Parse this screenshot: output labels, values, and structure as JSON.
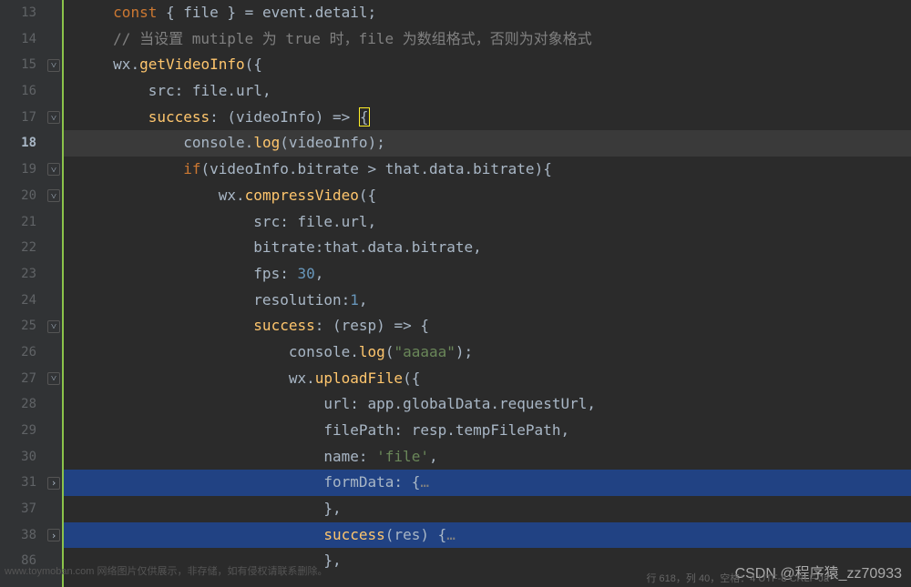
{
  "lines": [
    {
      "num": "13",
      "fold": "",
      "cls": ""
    },
    {
      "num": "14",
      "fold": "",
      "cls": ""
    },
    {
      "num": "15",
      "fold": "down",
      "cls": ""
    },
    {
      "num": "16",
      "fold": "",
      "cls": ""
    },
    {
      "num": "17",
      "fold": "down",
      "cls": ""
    },
    {
      "num": "18",
      "fold": "",
      "cls": "hl-row",
      "active": true
    },
    {
      "num": "19",
      "fold": "down",
      "cls": ""
    },
    {
      "num": "20",
      "fold": "down",
      "cls": ""
    },
    {
      "num": "21",
      "fold": "",
      "cls": ""
    },
    {
      "num": "22",
      "fold": "",
      "cls": ""
    },
    {
      "num": "23",
      "fold": "",
      "cls": ""
    },
    {
      "num": "24",
      "fold": "",
      "cls": ""
    },
    {
      "num": "25",
      "fold": "down",
      "cls": ""
    },
    {
      "num": "26",
      "fold": "",
      "cls": ""
    },
    {
      "num": "27",
      "fold": "down",
      "cls": ""
    },
    {
      "num": "28",
      "fold": "",
      "cls": ""
    },
    {
      "num": "29",
      "fold": "",
      "cls": ""
    },
    {
      "num": "30",
      "fold": "",
      "cls": ""
    },
    {
      "num": "31",
      "fold": "right",
      "cls": "selected"
    },
    {
      "num": "37",
      "fold": "",
      "cls": ""
    },
    {
      "num": "38",
      "fold": "right",
      "cls": "selected"
    },
    {
      "num": "86",
      "fold": "",
      "cls": ""
    }
  ],
  "code": {
    "l13_const": "const",
    "l13_destructure": " { file } = event.detail;",
    "l14_comment": "// 当设置 mutiple 为 true 时，file 为数组格式，否则为对象格式",
    "l15_wx": "wx",
    "l15_getVideoInfo": "getVideoInfo",
    "l16_src": "src",
    "l16_fileurl": "file.url,",
    "l17_success": "success",
    "l17_videoInfo": "videoInfo",
    "l18_console": "console",
    "l18_log": "log",
    "l18_arg": "videoInfo",
    "l19_if": "if",
    "l19_cond1": "videoInfo.bitrate > that.data.bitrate",
    "l20_wx": "wx",
    "l20_compressVideo": "compressVideo",
    "l21_src": "src",
    "l21_fileurl": "file.url,",
    "l22_bitrate": "bitrate",
    "l22_val": "that.data.bitrate,",
    "l23_fps": "fps",
    "l23_val": "30",
    "l24_resolution": "resolution",
    "l24_val": "1",
    "l25_success": "success",
    "l25_resp": "resp",
    "l26_console": "console",
    "l26_log": "log",
    "l26_str": "\"aaaaa\"",
    "l27_wx": "wx",
    "l27_uploadFile": "uploadFile",
    "l28_url": "url",
    "l28_val": "app.globalData.requestUrl,",
    "l29_filePath": "filePath",
    "l29_val": "resp.tempFilePath,",
    "l30_name": "name",
    "l30_str": "'file'",
    "l31_formData": "formData",
    "l31_fold": "…",
    "l37_close": "},",
    "l38_success": "success",
    "l38_res": "res",
    "l38_fold": "…",
    "l86_close": "},"
  },
  "watermark_left": "www.toymoban.com 网络图片仅供展示，非存储，如有侵权请联系删除。",
  "watermark_right": "CSDN @程序猿_zz70933",
  "status": "行 618，列 40，空格：4  UTF-8  CRLF  Ja"
}
